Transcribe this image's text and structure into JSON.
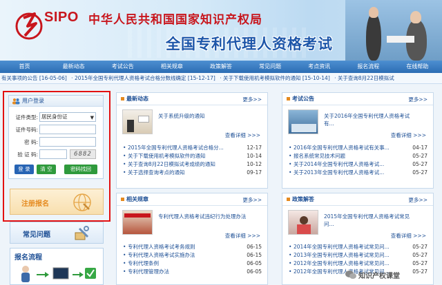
{
  "header": {
    "logo_text": "SIPO",
    "org_name": "中华人民共和国国家知识产权局",
    "exam_title": "全国专利代理人资格考试"
  },
  "nav": [
    "首页",
    "最新动态",
    "考试公告",
    "相关规章",
    "政策解答",
    "常见问题",
    "考点资讯",
    "报名流程",
    "在线帮助"
  ],
  "ticker": [
    "有关事项的公告 [16-05-06]",
    "· 2015年全国专利代理人资格考试合格分数线确定 [15-12-17]",
    "· 关于下载使用机考模拟软件的通知 [15-10-14]",
    "· 关于查询8月22日模拟试"
  ],
  "login": {
    "title": "用户登录",
    "id_type_label": "证件类型:",
    "id_type_value": "居民身份证",
    "id_number_label": "证件号码:",
    "password_label": "密    码:",
    "captcha_label": "验 证 码:",
    "captcha_value": "6882",
    "login_button": "登 录",
    "clear_button": "清 空",
    "recover_button": "密码找回"
  },
  "register": {
    "label": "注册报名"
  },
  "faq": {
    "label": "常见问题"
  },
  "flow": {
    "label": "报名流程"
  },
  "panels": {
    "news": {
      "title": "最新动态",
      "more": "更多>>",
      "feature": "关于系统升级的通知",
      "detail": "查看详细 >>>",
      "items": [
        {
          "text": "2015年全国专利代理人资格考试合格分...",
          "date": "12-17"
        },
        {
          "text": "关于下载使用机考模拟软件的通知",
          "date": "10-14"
        },
        {
          "text": "关于查询8月22日模拟试考成绩的通知",
          "date": "10-12"
        },
        {
          "text": "关于选择查询考点的通知",
          "date": "09-17"
        }
      ]
    },
    "notice": {
      "title": "考试公告",
      "more": "更多>>",
      "feature": "关于2016年全国专利代理人资格考试有...",
      "detail": "查看详细 >>>",
      "items": [
        {
          "text": "2016年全国专利代理人资格考试有关事...",
          "date": "04-17"
        },
        {
          "text": "报名系统常见技术问题",
          "date": "05-27"
        },
        {
          "text": "关于2014年全国专利代理人资格考试...",
          "date": "05-27"
        },
        {
          "text": "关于2013年全国专利代理人资格考试...",
          "date": "05-27"
        }
      ]
    },
    "rules": {
      "title": "相关规章",
      "more": "更多>>",
      "feature": "专利代理人资格考试违纪行为处理办法",
      "detail": "查看详细 >>>",
      "items": [
        {
          "text": "专利代理人资格考试考务规则",
          "date": "06-15"
        },
        {
          "text": "专利代理人资格考试实施办法",
          "date": "06-15"
        },
        {
          "text": "专利代理条例",
          "date": "06-05"
        },
        {
          "text": "专利代理管理办法",
          "date": "06-05"
        }
      ]
    },
    "policy": {
      "title": "政策解答",
      "more": "更多>>",
      "feature": "2015年全国专利代理人资格考试常见问...",
      "detail": "查看详细 >>>",
      "items": [
        {
          "text": "2014年全国专利代理人资格考试常见问...",
          "date": "05-27"
        },
        {
          "text": "2013年全国专利代理人资格考试常见问...",
          "date": "05-27"
        },
        {
          "text": "2012年全国专利代理人资格考试常见问...",
          "date": "05-27"
        },
        {
          "text": "2012年全国专利代理人资格考试常见问...",
          "date": "05-27"
        }
      ]
    }
  },
  "watermark": "知识产权课堂",
  "colors": {
    "accent": "#c8161d",
    "brand_blue": "#1d56a9",
    "highlight": "#e31010"
  }
}
